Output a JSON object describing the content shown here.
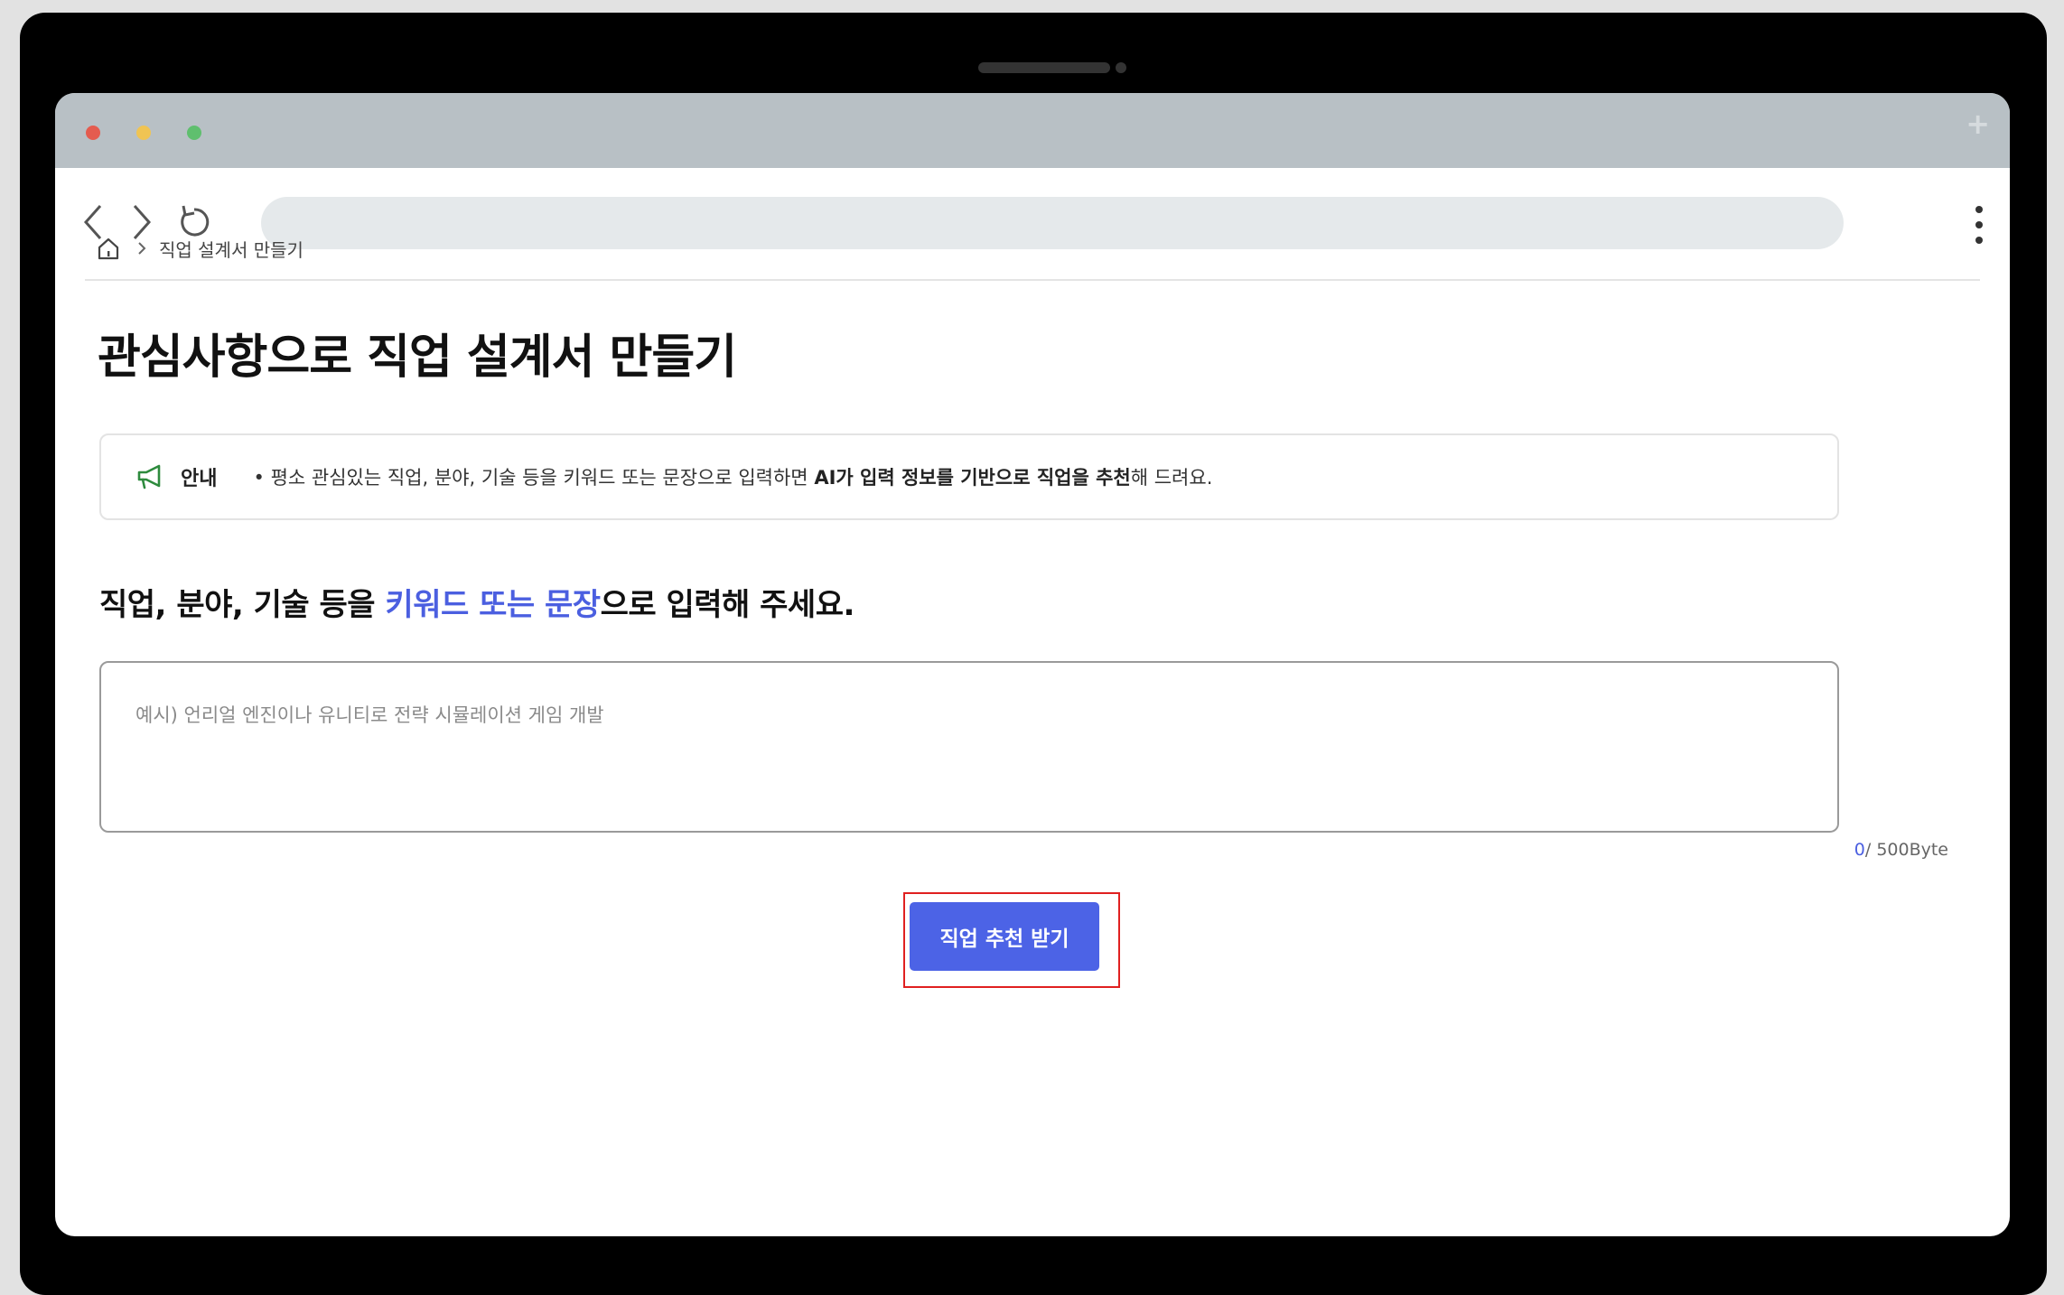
{
  "breadcrumb": {
    "home_icon": "home-icon",
    "separator_icon": "chevron-right-icon",
    "current": "직업 설계서 만들기"
  },
  "page": {
    "title": "관심사항으로 직업 설계서 만들기"
  },
  "notice": {
    "icon": "megaphone-icon",
    "label": "안내",
    "bullet": "•",
    "text_pre": "평소 관심있는 직업, 분야, 기술 등을 키워드 또는 문장으로 입력하면 ",
    "text_bold": "AI가 입력 정보를 기반으로 직업을 추천",
    "text_post": "해 드려요."
  },
  "prompt": {
    "pre": "직업, 분야, 기술 등을 ",
    "accent": "키워드 또는 문장",
    "post": "으로 입력해 주세요."
  },
  "input": {
    "value": "",
    "placeholder": "예시) 언리얼 엔진이나 유니티로 전략 시뮬레이션 게임 개발"
  },
  "counter": {
    "count": "0",
    "limit": "/ 500Byte"
  },
  "actions": {
    "submit_label": "직업 추천 받기"
  },
  "colors": {
    "accent": "#4b5fe0",
    "button": "#4c63e6",
    "highlight": "#e02020",
    "notice_icon": "#2e8b3e"
  }
}
